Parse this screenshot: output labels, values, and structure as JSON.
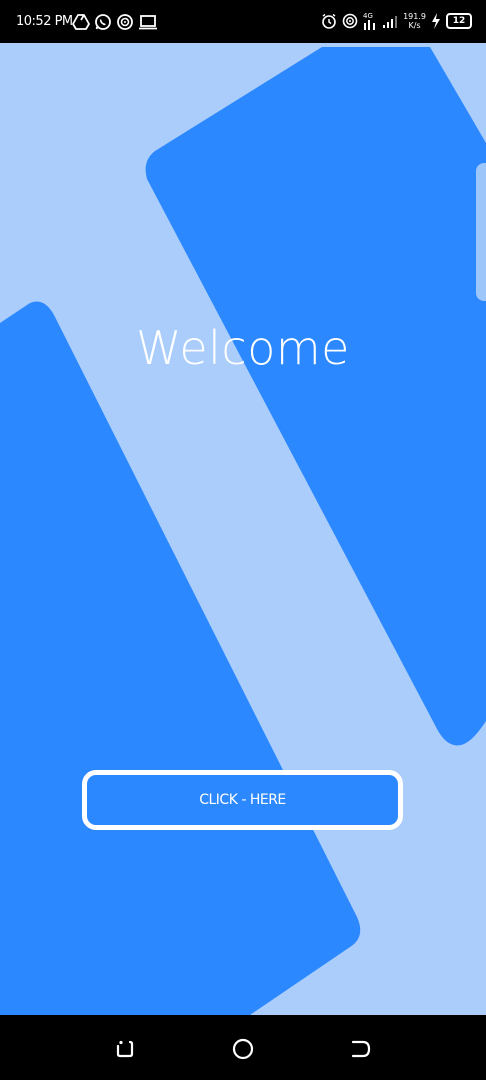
{
  "status_bar": {
    "time": "10:52 PM",
    "left_icons": [
      "drive-icon",
      "whatsapp-icon",
      "hotspot-icon",
      "laptop-icon"
    ],
    "right_icons": [
      "alarm-icon",
      "hotspot-icon",
      "signal-4g-icon",
      "signal-icon",
      "charging-icon"
    ],
    "network_speed_value": "191.9",
    "network_speed_unit": "K/s",
    "battery": "12"
  },
  "main": {
    "welcome_text": "Welcome",
    "button_label": "CLICK - HERE"
  },
  "colors": {
    "background": "#aacdfb",
    "accent": "#2b88ff",
    "bars": "#000000"
  },
  "nav_bar": {
    "buttons": [
      "recent-apps-icon",
      "home-icon",
      "back-icon"
    ]
  }
}
